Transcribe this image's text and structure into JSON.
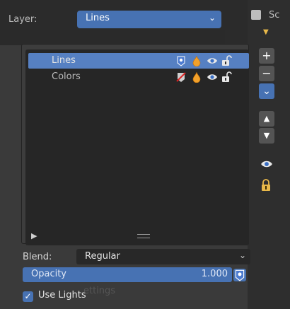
{
  "header": {
    "layer_label": "Layer:",
    "layer_value": "Lines",
    "right_text": "Sc"
  },
  "layers": [
    {
      "name": "Lines",
      "selected": true,
      "icons": [
        "mask-blue-icon",
        "fill-orange-icon",
        "eye-icon",
        "unlock-icon"
      ]
    },
    {
      "name": "Colors",
      "selected": false,
      "icons": [
        "mask-off-icon",
        "fill-orange-icon",
        "eye-icon",
        "unlock-icon"
      ]
    }
  ],
  "side": {
    "add": "+",
    "remove": "−",
    "menu": "⌄",
    "up": "▲",
    "down": "▼"
  },
  "blend": {
    "label": "Blend:",
    "value": "Regular"
  },
  "opacity": {
    "label": "Opacity",
    "value": "1.000"
  },
  "use_lights": {
    "label": "Use Lights",
    "checked": true
  },
  "ghost_text": "ettings",
  "colors": {
    "accent": "#4772b3",
    "selected_row": "#5680c2",
    "lock": "#e9b94a",
    "fill": "#f2a12b"
  }
}
